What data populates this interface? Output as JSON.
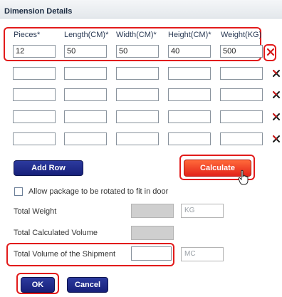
{
  "dialog": {
    "title": "Dimension Details"
  },
  "columns": [
    "Pieces*",
    "Length(CM)*",
    "Width(CM)*",
    "Height(CM)*",
    "Weight(KG)"
  ],
  "rows": [
    [
      "12",
      "50",
      "50",
      "40",
      "500"
    ],
    [
      "",
      "",
      "",
      "",
      ""
    ],
    [
      "",
      "",
      "",
      "",
      ""
    ],
    [
      "",
      "",
      "",
      "",
      ""
    ],
    [
      "",
      "",
      "",
      "",
      ""
    ]
  ],
  "buttons": {
    "add_row": "Add Row",
    "calculate": "Calculate",
    "ok": "OK",
    "cancel": "Cancel"
  },
  "options": {
    "rotate_label": "Allow package to be rotated to fit in door",
    "rotate_checked": false
  },
  "totals": {
    "weight_label": "Total Weight",
    "weight_unit": "KG",
    "calc_volume_label": "Total Calculated Volume",
    "shipment_volume_label": "Total Volume of the Shipment",
    "volume_unit": "MC"
  },
  "icons": {
    "delete_row": "close-x-icon",
    "cursor": "hand-pointer-icon"
  },
  "colors": {
    "highlight": "#e21b1b",
    "primary": "#1a2280",
    "calculate": "#e8301d"
  }
}
